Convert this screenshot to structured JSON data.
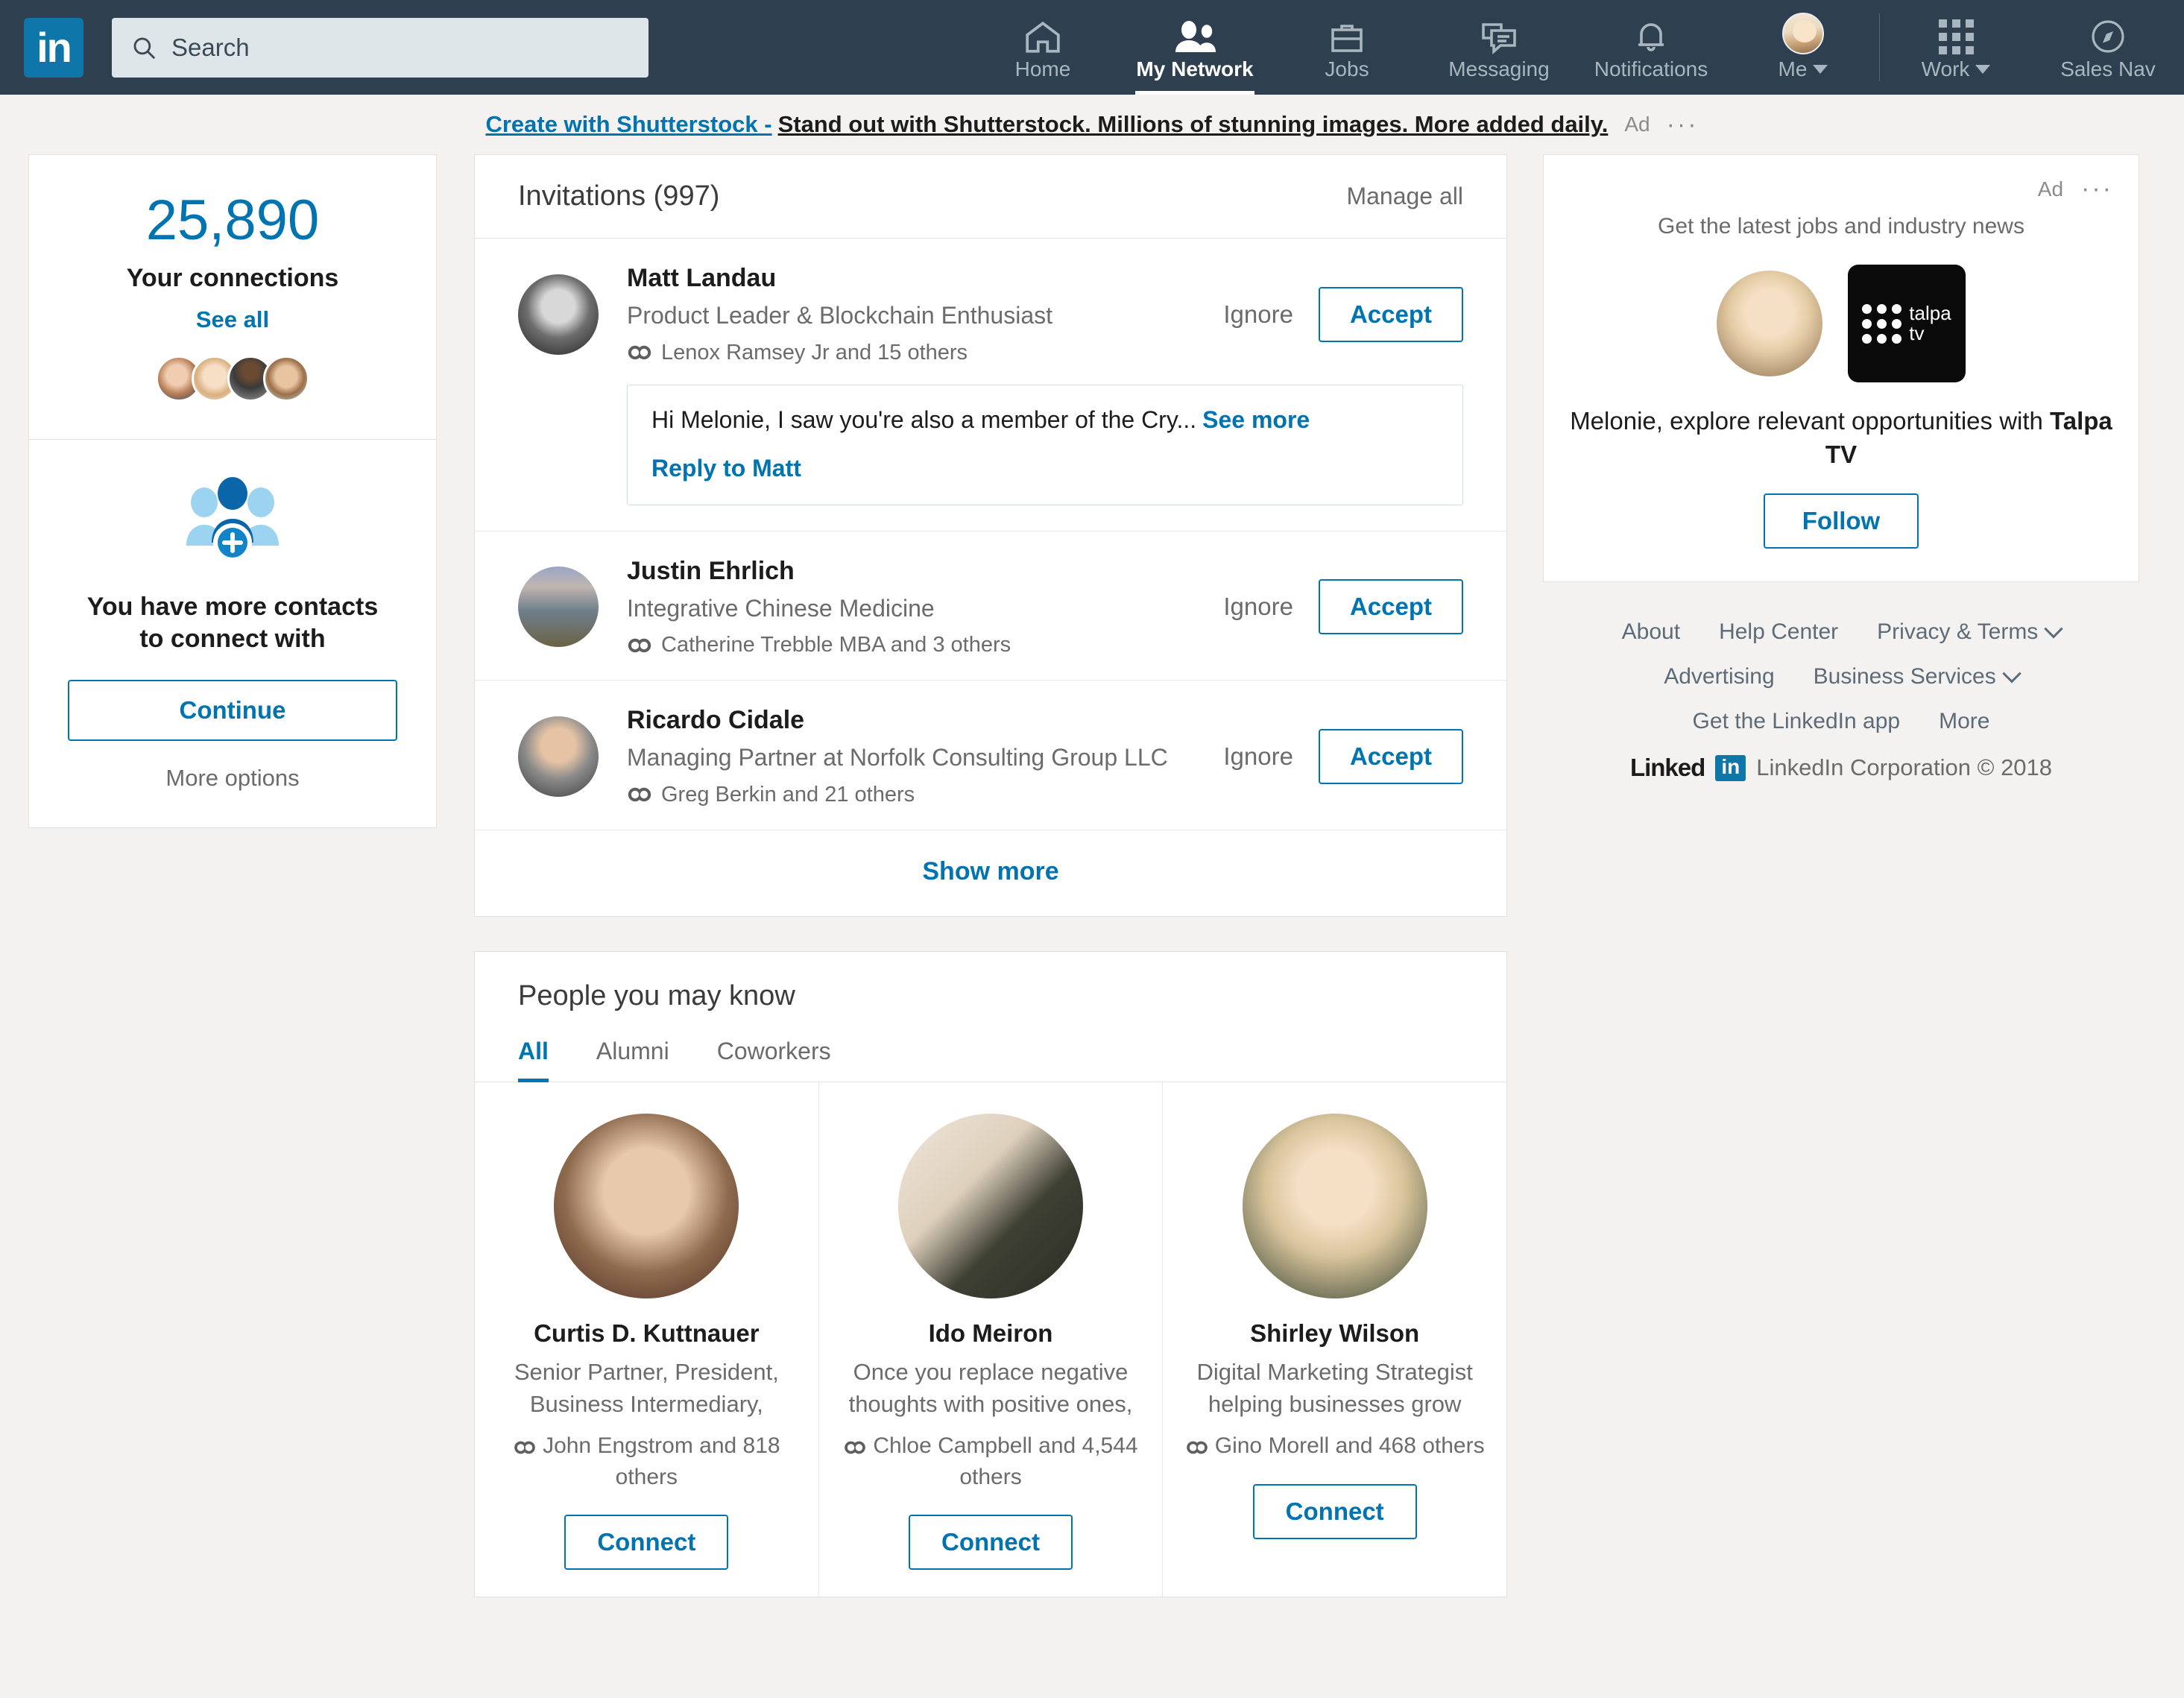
{
  "colors": {
    "nav_bg": "#2e4050",
    "brand_blue": "#0073b1",
    "logo_blue": "#0e76a8",
    "page_bg": "#f3f2f0"
  },
  "nav": {
    "logo_text": "in",
    "search_placeholder": "Search",
    "search_value": "",
    "items": [
      {
        "label": "Home",
        "icon": "home-icon",
        "active": false
      },
      {
        "label": "My Network",
        "icon": "network-icon",
        "active": true
      },
      {
        "label": "Jobs",
        "icon": "briefcase-icon",
        "active": false
      },
      {
        "label": "Messaging",
        "icon": "messaging-icon",
        "active": false
      },
      {
        "label": "Notifications",
        "icon": "bell-icon",
        "active": false
      },
      {
        "label": "Me",
        "icon": "avatar-icon",
        "active": false
      },
      {
        "label": "Work",
        "icon": "grid-icon",
        "active": false
      },
      {
        "label": "Sales Nav",
        "icon": "compass-icon",
        "active": false
      }
    ]
  },
  "ad_banner": {
    "link_text": "Create with Shutterstock -",
    "body_text": "Stand out with Shutterstock. Millions of stunning images. More added daily.",
    "ad_tag": "Ad",
    "overflow": "···"
  },
  "connections_card": {
    "count": "25,890",
    "label": "Your connections",
    "see_all": "See all"
  },
  "contacts_card": {
    "title_line1": "You have more contacts",
    "title_line2": "to connect with",
    "continue_label": "Continue",
    "more_options": "More options"
  },
  "invitations": {
    "title": "Invitations (997)",
    "manage_all": "Manage all",
    "show_more": "Show more",
    "ignore_label": "Ignore",
    "accept_label": "Accept",
    "items": [
      {
        "name": "Matt Landau",
        "headline": "Product Leader & Blockchain Enthusiast",
        "mutual": "Lenox Ramsey Jr and 15 others",
        "message": "Hi Melonie, I saw you're also a member of the Cry...",
        "see_more": "See more",
        "reply": "Reply to Matt"
      },
      {
        "name": "Justin Ehrlich",
        "headline": "Integrative Chinese Medicine",
        "mutual": "Catherine Trebble MBA and 3 others"
      },
      {
        "name": "Ricardo Cidale",
        "headline": "Managing Partner at Norfolk Consulting Group LLC",
        "mutual": "Greg Berkin and 21 others"
      }
    ]
  },
  "pymk": {
    "title": "People you may know",
    "tabs": [
      {
        "label": "All",
        "active": true
      },
      {
        "label": "Alumni",
        "active": false
      },
      {
        "label": "Coworkers",
        "active": false
      }
    ],
    "connect_label": "Connect",
    "people": [
      {
        "name": "Curtis D. Kuttnauer",
        "headline": "Senior Partner, President, Business Intermediary,",
        "mutual": "John Engstrom and 818 others"
      },
      {
        "name": "Ido Meiron",
        "headline": "Once you replace negative thoughts with positive ones,",
        "mutual": "Chloe Campbell and 4,544 others"
      },
      {
        "name": "Shirley Wilson",
        "headline": "Digital Marketing Strategist helping businesses grow",
        "mutual": "Gino Morell and 468 others"
      }
    ]
  },
  "ad_card": {
    "ad_tag": "Ad",
    "overflow": "···",
    "subtitle": "Get the latest jobs and industry news",
    "brand_word_top": "talpa",
    "brand_word_bottom": "tv",
    "headline_prefix": "Melonie, explore relevant opportunities with ",
    "headline_brand": "Talpa TV",
    "follow_label": "Follow"
  },
  "footer": {
    "row1": [
      {
        "label": "About",
        "chevron": false
      },
      {
        "label": "Help Center",
        "chevron": false
      },
      {
        "label": "Privacy & Terms",
        "chevron": true
      }
    ],
    "row2": [
      {
        "label": "Advertising",
        "chevron": false
      },
      {
        "label": "Business Services",
        "chevron": true
      }
    ],
    "row3": [
      {
        "label": "Get the LinkedIn app",
        "chevron": false
      },
      {
        "label": "More",
        "chevron": false
      }
    ],
    "brand_linked": "Linked",
    "brand_in": "in",
    "copyright": "LinkedIn Corporation © 2018"
  }
}
